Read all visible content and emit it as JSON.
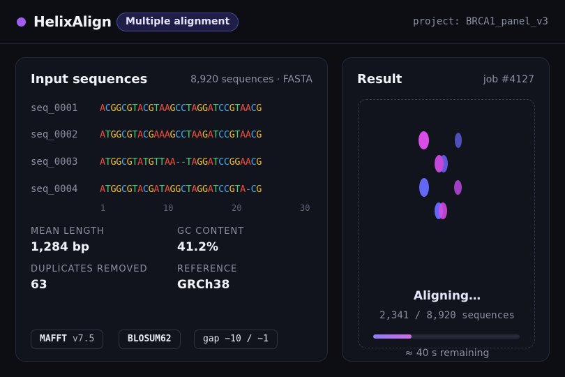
{
  "header": {
    "brand": "HelixAlign",
    "mode_badge": "Multiple alignment",
    "project": "project: BRCA1_panel_v3",
    "brand_color": "#a35cf0"
  },
  "input_card": {
    "title": "Input sequences",
    "meta": "8,920 sequences · FASTA",
    "sequences": [
      {
        "name": "seq_0001",
        "bases": "ACGGCGTACGTAAGCCTAGGATCCGTAACG"
      },
      {
        "name": "seq_0002",
        "bases": "ATGGCGTACGAAAGCCTAAGATCCGTAACG"
      },
      {
        "name": "seq_0003",
        "bases": "ATGGCGTATGTTAA--TAGGATCCGGAACG"
      },
      {
        "name": "seq_0004",
        "bases": "ATGGCGTACGATAGGCTAGGATCCGTA-CG"
      }
    ],
    "ruler": [
      "1",
      "10",
      "20",
      "30"
    ],
    "stats": {
      "mean_length_label": "MEAN LENGTH",
      "mean_length_value": "1,284 bp",
      "gc_label": "GC CONTENT",
      "gc_value": "41.2%",
      "dup_label": "DUPLICATES REMOVED",
      "dup_value": "63",
      "ref_label": "REFERENCE",
      "ref_value": "GRCh38"
    },
    "chips": {
      "aligner_name": "MAFFT",
      "aligner_version": " v7.5",
      "matrix": "BLOSUM62",
      "gap": "gap −10 / −1"
    },
    "base_colors": {
      "A": "#e74c3c",
      "C": "#3fb0ee",
      "G": "#f0c030",
      "T": "#4cd17a",
      "gap": "#7d8396"
    }
  },
  "result_card": {
    "title": "Result",
    "job": "job #4127",
    "status": "Aligning…",
    "progress_text": "2,341 / 8,920 sequences",
    "progress_fraction": 0.262,
    "remaining": "≈ 40 s remaining",
    "progress_gradient": [
      "#8e7cf7",
      "#d06be8"
    ]
  }
}
